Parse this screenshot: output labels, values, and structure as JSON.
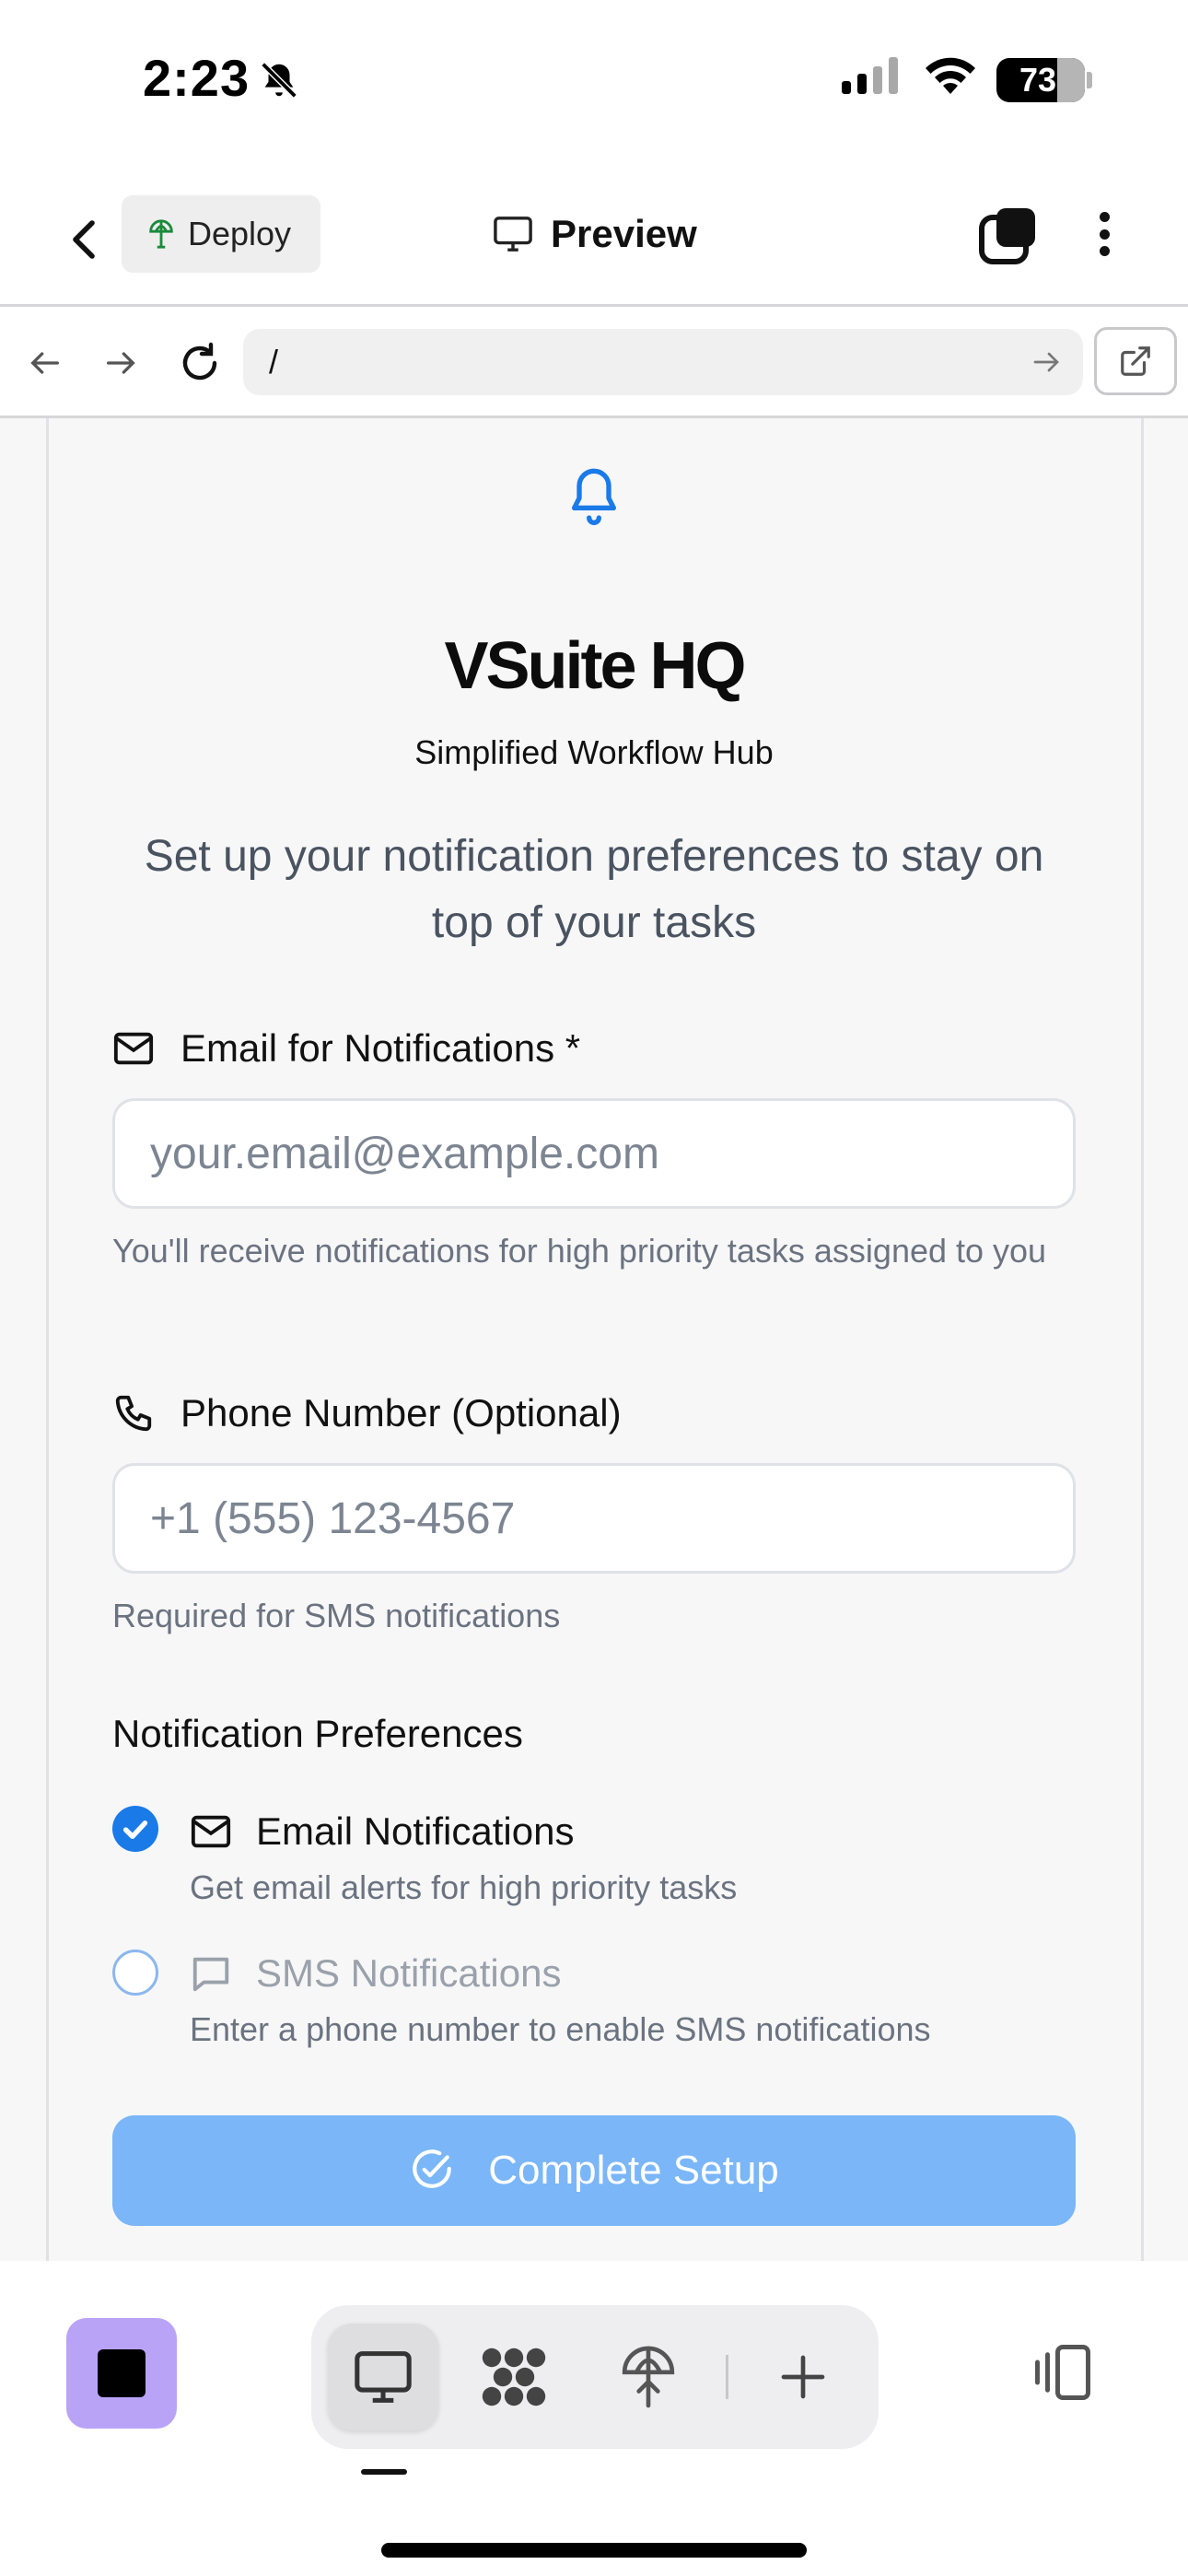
{
  "status_bar": {
    "time": "2:23",
    "battery": "73"
  },
  "header": {
    "deploy_label": "Deploy",
    "title": "Preview"
  },
  "browser": {
    "url": "/"
  },
  "page": {
    "brand": "VSuite HQ",
    "tagline": "Simplified Workflow Hub",
    "intro": "Set up your notification preferences to stay on top of your tasks",
    "email": {
      "label": "Email for Notifications *",
      "placeholder": "your.email@example.com",
      "helper": "You'll receive notifications for high priority tasks assigned to you"
    },
    "phone": {
      "label": "Phone Number (Optional)",
      "placeholder": "+1 (555) 123-4567",
      "helper": "Required for SMS notifications"
    },
    "preferences": {
      "heading": "Notification Preferences",
      "options": [
        {
          "title": "Email Notifications",
          "description": "Get email alerts for high priority tasks",
          "checked": true
        },
        {
          "title": "SMS Notifications",
          "description": "Enter a phone number to enable SMS notifications",
          "checked": false
        }
      ]
    },
    "submit_label": "Complete Setup"
  },
  "colors": {
    "accent": "#1a7ae8",
    "button_disabled": "#7ab6f8",
    "stop_button": "#b9a3f7"
  },
  "icons": [
    "bell-muted-icon",
    "cellular-icon",
    "wifi-icon",
    "chevron-left-icon",
    "globe-icon",
    "monitor-icon",
    "tabs-icon",
    "more-icon",
    "arrow-left-icon",
    "arrow-right-icon",
    "reload-icon",
    "external-link-icon",
    "bell-icon",
    "mail-icon",
    "phone-icon",
    "message-icon",
    "check-circle-icon",
    "stop-icon",
    "desktop-icon",
    "apps-icon",
    "deploy-icon",
    "plus-icon",
    "device-toggle-icon"
  ]
}
